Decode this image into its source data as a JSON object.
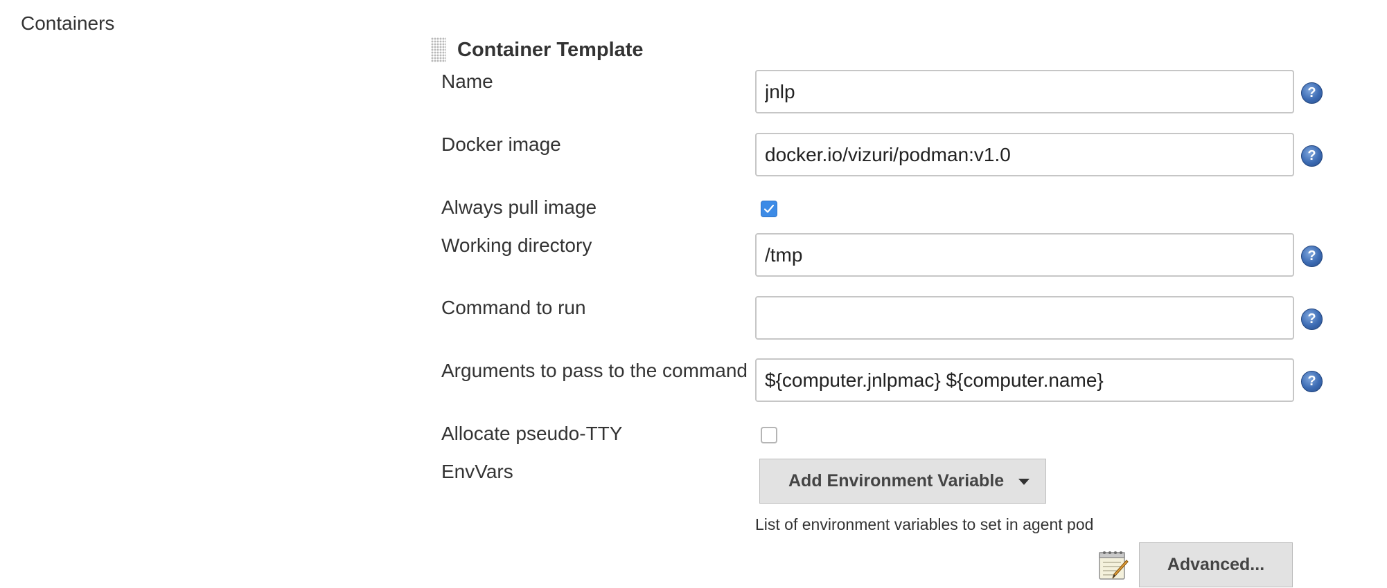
{
  "section": {
    "label": "Containers"
  },
  "container_template": {
    "title": "Container Template",
    "fields": {
      "name": {
        "label": "Name",
        "value": "jnlp",
        "help": "?"
      },
      "docker_image": {
        "label": "Docker image",
        "value": "docker.io/vizuri/podman:v1.0",
        "help": "?"
      },
      "always_pull_image": {
        "label": "Always pull image",
        "checked": true
      },
      "working_directory": {
        "label": "Working directory",
        "value": "/tmp",
        "help": "?"
      },
      "command_to_run": {
        "label": "Command to run",
        "value": "",
        "help": "?"
      },
      "arguments": {
        "label": "Arguments to pass to the command",
        "value": "${computer.jnlpmac} ${computer.name}",
        "help": "?"
      },
      "allocate_pseudo_tty": {
        "label": "Allocate pseudo-TTY",
        "checked": false
      },
      "env_vars": {
        "label": "EnvVars",
        "add_button_label": "Add Environment Variable",
        "hint": "List of environment variables to set in agent pod"
      }
    },
    "advanced_button_label": "Advanced...",
    "icons": {
      "drag_handle": "drag-handle-icon",
      "help": "help-icon",
      "notepad": "notepad-icon",
      "dropdown_caret": "chevron-down-icon"
    },
    "colors": {
      "checkbox_checked": "#3d8be6",
      "help_icon": "#3c6bb3",
      "button_bg": "#e2e2e2"
    }
  }
}
